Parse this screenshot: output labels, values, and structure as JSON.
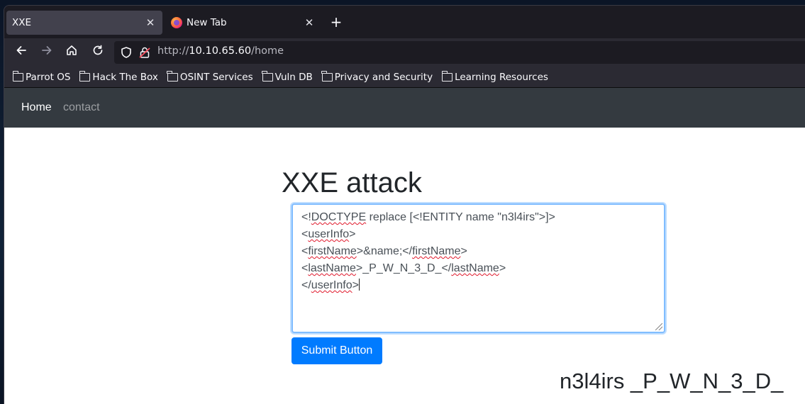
{
  "tabs": [
    {
      "title": "XXE",
      "active": true
    },
    {
      "title": "New Tab",
      "active": false
    }
  ],
  "address_bar": {
    "scheme": "http://",
    "host": "10.10.65.60",
    "path": "/home"
  },
  "bookmarks": [
    "Parrot OS",
    "Hack The Box",
    "OSINT Services",
    "Vuln DB",
    "Privacy and Security",
    "Learning Resources"
  ],
  "site_nav": {
    "home": "Home",
    "contact": "contact"
  },
  "main": {
    "heading": "XXE attack",
    "xml_lines": [
      "<!DOCTYPE replace [<!ENTITY name \"n3l4irs\">]>",
      "<userInfo>",
      "<firstName>&name;</firstName>",
      "<lastName>_P_W_N_3_D_</lastName>",
      "</userInfo>"
    ],
    "submit_label": "Submit Button",
    "result": "n3l4irs _P_W_N_3_D_"
  },
  "colors": {
    "accent": "#007bff",
    "navbar": "#343a40",
    "focus_border": "#80bdff"
  }
}
